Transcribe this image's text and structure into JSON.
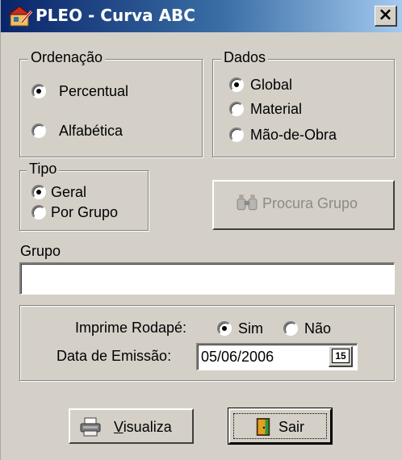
{
  "window": {
    "title": "PLEO - Curva ABC",
    "close_label": "×"
  },
  "ordenacao": {
    "legend": "Ordenação",
    "options": [
      "Percentual",
      "Alfabética"
    ],
    "selected": "Percentual"
  },
  "dados": {
    "legend": "Dados",
    "options": [
      "Global",
      "Material",
      "Mão-de-Obra"
    ],
    "selected": "Global"
  },
  "tipo": {
    "legend": "Tipo",
    "options": [
      "Geral",
      "Por Grupo"
    ],
    "selected": "Geral"
  },
  "procura_grupo": {
    "label": "Procura Grupo",
    "enabled": false
  },
  "grupo": {
    "label": "Grupo",
    "value": ""
  },
  "rodape": {
    "label": "Imprime Rodapé:",
    "options": [
      "Sim",
      "Não"
    ],
    "selected": "Sim"
  },
  "emissao": {
    "label": "Data de Emissão:",
    "value": "05/06/2006",
    "calendar_label": "15"
  },
  "buttons": {
    "visualiza_prefix": "V",
    "visualiza_rest": "isualiza",
    "sair": "Sair"
  },
  "icons": {
    "title": "app-icon",
    "procura": "binoculars-icon",
    "visualiza": "printer-icon",
    "sair": "door-exit-icon",
    "calendar": "calendar-icon"
  }
}
